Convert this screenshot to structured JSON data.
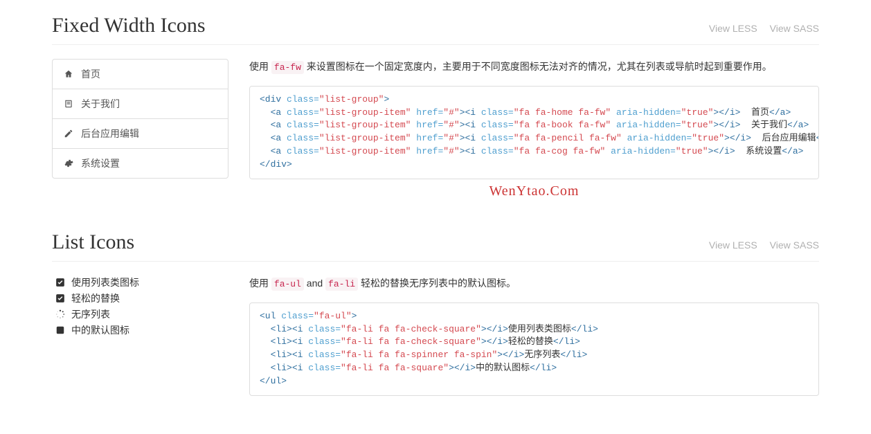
{
  "sections": {
    "fixed": {
      "title": "Fixed Width Icons",
      "view_less": "View LESS",
      "view_sass": "View SASS",
      "nav": [
        {
          "icon": "home",
          "label": "首页"
        },
        {
          "icon": "book",
          "label": "关于我们"
        },
        {
          "icon": "pencil",
          "label": "后台应用编辑"
        },
        {
          "icon": "cog",
          "label": "系统设置"
        }
      ],
      "desc_pre": "使用 ",
      "desc_code": "fa-fw",
      "desc_post": " 来设置图标在一个固定宽度内，主要用于不同宽度图标无法对齐的情况，尤其在列表或导航时起到重要作用。",
      "code_lines": [
        [
          {
            "t": "tag",
            "v": "<div"
          },
          {
            "t": "txt",
            "v": " "
          },
          {
            "t": "attr",
            "v": "class="
          },
          {
            "t": "val",
            "v": "\"list-group\""
          },
          {
            "t": "tag",
            "v": ">"
          }
        ],
        [
          {
            "t": "txt",
            "v": "  "
          },
          {
            "t": "tag",
            "v": "<a"
          },
          {
            "t": "txt",
            "v": " "
          },
          {
            "t": "attr",
            "v": "class="
          },
          {
            "t": "val",
            "v": "\"list-group-item\""
          },
          {
            "t": "txt",
            "v": " "
          },
          {
            "t": "attr",
            "v": "href="
          },
          {
            "t": "val",
            "v": "\"#\""
          },
          {
            "t": "tag",
            "v": "><i"
          },
          {
            "t": "txt",
            "v": " "
          },
          {
            "t": "attr",
            "v": "class="
          },
          {
            "t": "val",
            "v": "\"fa fa-home fa-fw\""
          },
          {
            "t": "txt",
            "v": " "
          },
          {
            "t": "attr",
            "v": "aria-hidden="
          },
          {
            "t": "val",
            "v": "\"true\""
          },
          {
            "t": "tag",
            "v": "></i>"
          },
          {
            "t": "txt",
            "v": "&nbsp; 首页"
          },
          {
            "t": "tag",
            "v": "</a>"
          }
        ],
        [
          {
            "t": "txt",
            "v": "  "
          },
          {
            "t": "tag",
            "v": "<a"
          },
          {
            "t": "txt",
            "v": " "
          },
          {
            "t": "attr",
            "v": "class="
          },
          {
            "t": "val",
            "v": "\"list-group-item\""
          },
          {
            "t": "txt",
            "v": " "
          },
          {
            "t": "attr",
            "v": "href="
          },
          {
            "t": "val",
            "v": "\"#\""
          },
          {
            "t": "tag",
            "v": "><i"
          },
          {
            "t": "txt",
            "v": " "
          },
          {
            "t": "attr",
            "v": "class="
          },
          {
            "t": "val",
            "v": "\"fa fa-book fa-fw\""
          },
          {
            "t": "txt",
            "v": " "
          },
          {
            "t": "attr",
            "v": "aria-hidden="
          },
          {
            "t": "val",
            "v": "\"true\""
          },
          {
            "t": "tag",
            "v": "></i>"
          },
          {
            "t": "txt",
            "v": "&nbsp; 关于我们"
          },
          {
            "t": "tag",
            "v": "</a>"
          }
        ],
        [
          {
            "t": "txt",
            "v": "  "
          },
          {
            "t": "tag",
            "v": "<a"
          },
          {
            "t": "txt",
            "v": " "
          },
          {
            "t": "attr",
            "v": "class="
          },
          {
            "t": "val",
            "v": "\"list-group-item\""
          },
          {
            "t": "txt",
            "v": " "
          },
          {
            "t": "attr",
            "v": "href="
          },
          {
            "t": "val",
            "v": "\"#\""
          },
          {
            "t": "tag",
            "v": "><i"
          },
          {
            "t": "txt",
            "v": " "
          },
          {
            "t": "attr",
            "v": "class="
          },
          {
            "t": "val",
            "v": "\"fa fa-pencil fa-fw\""
          },
          {
            "t": "txt",
            "v": " "
          },
          {
            "t": "attr",
            "v": "aria-hidden="
          },
          {
            "t": "val",
            "v": "\"true\""
          },
          {
            "t": "tag",
            "v": "></i>"
          },
          {
            "t": "txt",
            "v": "&nbsp; 后台应用编辑"
          },
          {
            "t": "tag",
            "v": "</a>"
          }
        ],
        [
          {
            "t": "txt",
            "v": "  "
          },
          {
            "t": "tag",
            "v": "<a"
          },
          {
            "t": "txt",
            "v": " "
          },
          {
            "t": "attr",
            "v": "class="
          },
          {
            "t": "val",
            "v": "\"list-group-item\""
          },
          {
            "t": "txt",
            "v": " "
          },
          {
            "t": "attr",
            "v": "href="
          },
          {
            "t": "val",
            "v": "\"#\""
          },
          {
            "t": "tag",
            "v": "><i"
          },
          {
            "t": "txt",
            "v": " "
          },
          {
            "t": "attr",
            "v": "class="
          },
          {
            "t": "val",
            "v": "\"fa fa-cog fa-fw\""
          },
          {
            "t": "txt",
            "v": " "
          },
          {
            "t": "attr",
            "v": "aria-hidden="
          },
          {
            "t": "val",
            "v": "\"true\""
          },
          {
            "t": "tag",
            "v": "></i>"
          },
          {
            "t": "txt",
            "v": "&nbsp; 系统设置"
          },
          {
            "t": "tag",
            "v": "</a>"
          }
        ],
        [
          {
            "t": "tag",
            "v": "</div>"
          }
        ]
      ]
    },
    "list": {
      "title": "List Icons",
      "view_less": "View LESS",
      "view_sass": "View SASS",
      "items": [
        {
          "icon": "check-square",
          "label": "使用列表类图标"
        },
        {
          "icon": "check-square",
          "label": "轻松的替换"
        },
        {
          "icon": "spinner",
          "label": "无序列表"
        },
        {
          "icon": "square",
          "label": "中的默认图标"
        }
      ],
      "desc_pre": "使用 ",
      "desc_code1": "fa-ul",
      "desc_and": " and ",
      "desc_code2": "fa-li",
      "desc_post": " 轻松的替换无序列表中的默认图标。",
      "code_lines": [
        [
          {
            "t": "tag",
            "v": "<ul"
          },
          {
            "t": "txt",
            "v": " "
          },
          {
            "t": "attr",
            "v": "class="
          },
          {
            "t": "val",
            "v": "\"fa-ul\""
          },
          {
            "t": "tag",
            "v": ">"
          }
        ],
        [
          {
            "t": "txt",
            "v": "  "
          },
          {
            "t": "tag",
            "v": "<li><i"
          },
          {
            "t": "txt",
            "v": " "
          },
          {
            "t": "attr",
            "v": "class="
          },
          {
            "t": "val",
            "v": "\"fa-li fa fa-check-square\""
          },
          {
            "t": "tag",
            "v": "></i>"
          },
          {
            "t": "txt",
            "v": "使用列表类图标"
          },
          {
            "t": "tag",
            "v": "</li>"
          }
        ],
        [
          {
            "t": "txt",
            "v": "  "
          },
          {
            "t": "tag",
            "v": "<li><i"
          },
          {
            "t": "txt",
            "v": " "
          },
          {
            "t": "attr",
            "v": "class="
          },
          {
            "t": "val",
            "v": "\"fa-li fa fa-check-square\""
          },
          {
            "t": "tag",
            "v": "></i>"
          },
          {
            "t": "txt",
            "v": "轻松的替换"
          },
          {
            "t": "tag",
            "v": "</li>"
          }
        ],
        [
          {
            "t": "txt",
            "v": "  "
          },
          {
            "t": "tag",
            "v": "<li><i"
          },
          {
            "t": "txt",
            "v": " "
          },
          {
            "t": "attr",
            "v": "class="
          },
          {
            "t": "val",
            "v": "\"fa-li fa fa-spinner fa-spin\""
          },
          {
            "t": "tag",
            "v": "></i>"
          },
          {
            "t": "txt",
            "v": "无序列表"
          },
          {
            "t": "tag",
            "v": "</li>"
          }
        ],
        [
          {
            "t": "txt",
            "v": "  "
          },
          {
            "t": "tag",
            "v": "<li><i"
          },
          {
            "t": "txt",
            "v": " "
          },
          {
            "t": "attr",
            "v": "class="
          },
          {
            "t": "val",
            "v": "\"fa-li fa fa-square\""
          },
          {
            "t": "tag",
            "v": "></i>"
          },
          {
            "t": "txt",
            "v": "中的默认图标"
          },
          {
            "t": "tag",
            "v": "</li>"
          }
        ],
        [
          {
            "t": "tag",
            "v": "</ul>"
          }
        ]
      ]
    }
  },
  "watermark": "WenYtao.Com"
}
